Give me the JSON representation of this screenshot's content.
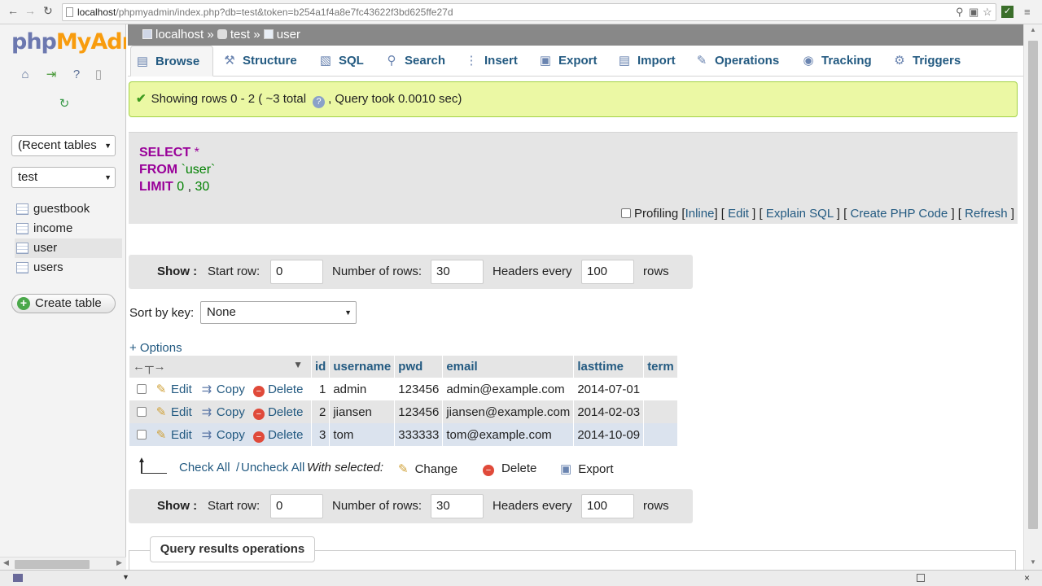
{
  "browser": {
    "url_host": "localhost",
    "url_path": "/phpmyadmin/index.php?db=test&token=b254a1f4a8e7fc43622f3bd625ffe27d"
  },
  "sidebar": {
    "logo_a": "php",
    "logo_b": "MyAdmin",
    "recent_tables": "(Recent tables",
    "db_select": "test",
    "tables": [
      "guestbook",
      "income",
      "user",
      "users"
    ],
    "selected_table": "user",
    "create_table": "Create table"
  },
  "breadcrumb": {
    "server": "localhost",
    "db": "test",
    "table": "user",
    "sep": "»"
  },
  "tabs": [
    {
      "label": "Browse",
      "icon": "browse-icon"
    },
    {
      "label": "Structure",
      "icon": "structure-icon"
    },
    {
      "label": "SQL",
      "icon": "sql-icon"
    },
    {
      "label": "Search",
      "icon": "search-icon"
    },
    {
      "label": "Insert",
      "icon": "insert-icon"
    },
    {
      "label": "Export",
      "icon": "export-icon"
    },
    {
      "label": "Import",
      "icon": "import-icon"
    },
    {
      "label": "Operations",
      "icon": "operations-icon"
    },
    {
      "label": "Tracking",
      "icon": "tracking-icon"
    },
    {
      "label": "Triggers",
      "icon": "triggers-icon"
    }
  ],
  "success": {
    "text_a": "Showing rows 0 - 2 ( ~3 total",
    "text_b": ", Query took 0.0010 sec)"
  },
  "sql": {
    "select": "SELECT",
    "star": "*",
    "from": "FROM",
    "table": "`user`",
    "limit": "LIMIT",
    "limit_a": "0",
    "comma": ",",
    "limit_b": "30",
    "profiling": "Profiling",
    "inline": "Inline",
    "edit": "Edit",
    "explain": "Explain SQL",
    "create_php": "Create PHP Code",
    "refresh": "Refresh"
  },
  "nav": {
    "show": "Show :",
    "start_row_label": "Start row:",
    "start_row": "0",
    "num_rows_label": "Number of rows:",
    "num_rows": "30",
    "headers_label": "Headers every",
    "headers": "100",
    "rows": "rows"
  },
  "sort": {
    "label": "Sort by key:",
    "value": "None"
  },
  "options": "+ Options",
  "grid": {
    "columns": [
      "id",
      "username",
      "pwd",
      "email",
      "lasttime",
      "term"
    ],
    "rows": [
      {
        "id": "1",
        "username": "admin",
        "pwd": "123456",
        "email": "admin@example.com",
        "lasttime": "2014-07-01",
        "term": ""
      },
      {
        "id": "2",
        "username": "jiansen",
        "pwd": "123456",
        "email": "jiansen@example.com",
        "lasttime": "2014-02-03",
        "term": ""
      },
      {
        "id": "3",
        "username": "tom",
        "pwd": "333333",
        "email": "tom@example.com",
        "lasttime": "2014-10-09",
        "term": ""
      }
    ],
    "edit": "Edit",
    "copy": "Copy",
    "delete": "Delete"
  },
  "bulk": {
    "check_all": "Check All",
    "slash": "/",
    "uncheck_all": "Uncheck All",
    "with_selected": "With selected:",
    "change": "Change",
    "delete": "Delete",
    "export": "Export"
  },
  "query_results_operations": "Query results operations"
}
